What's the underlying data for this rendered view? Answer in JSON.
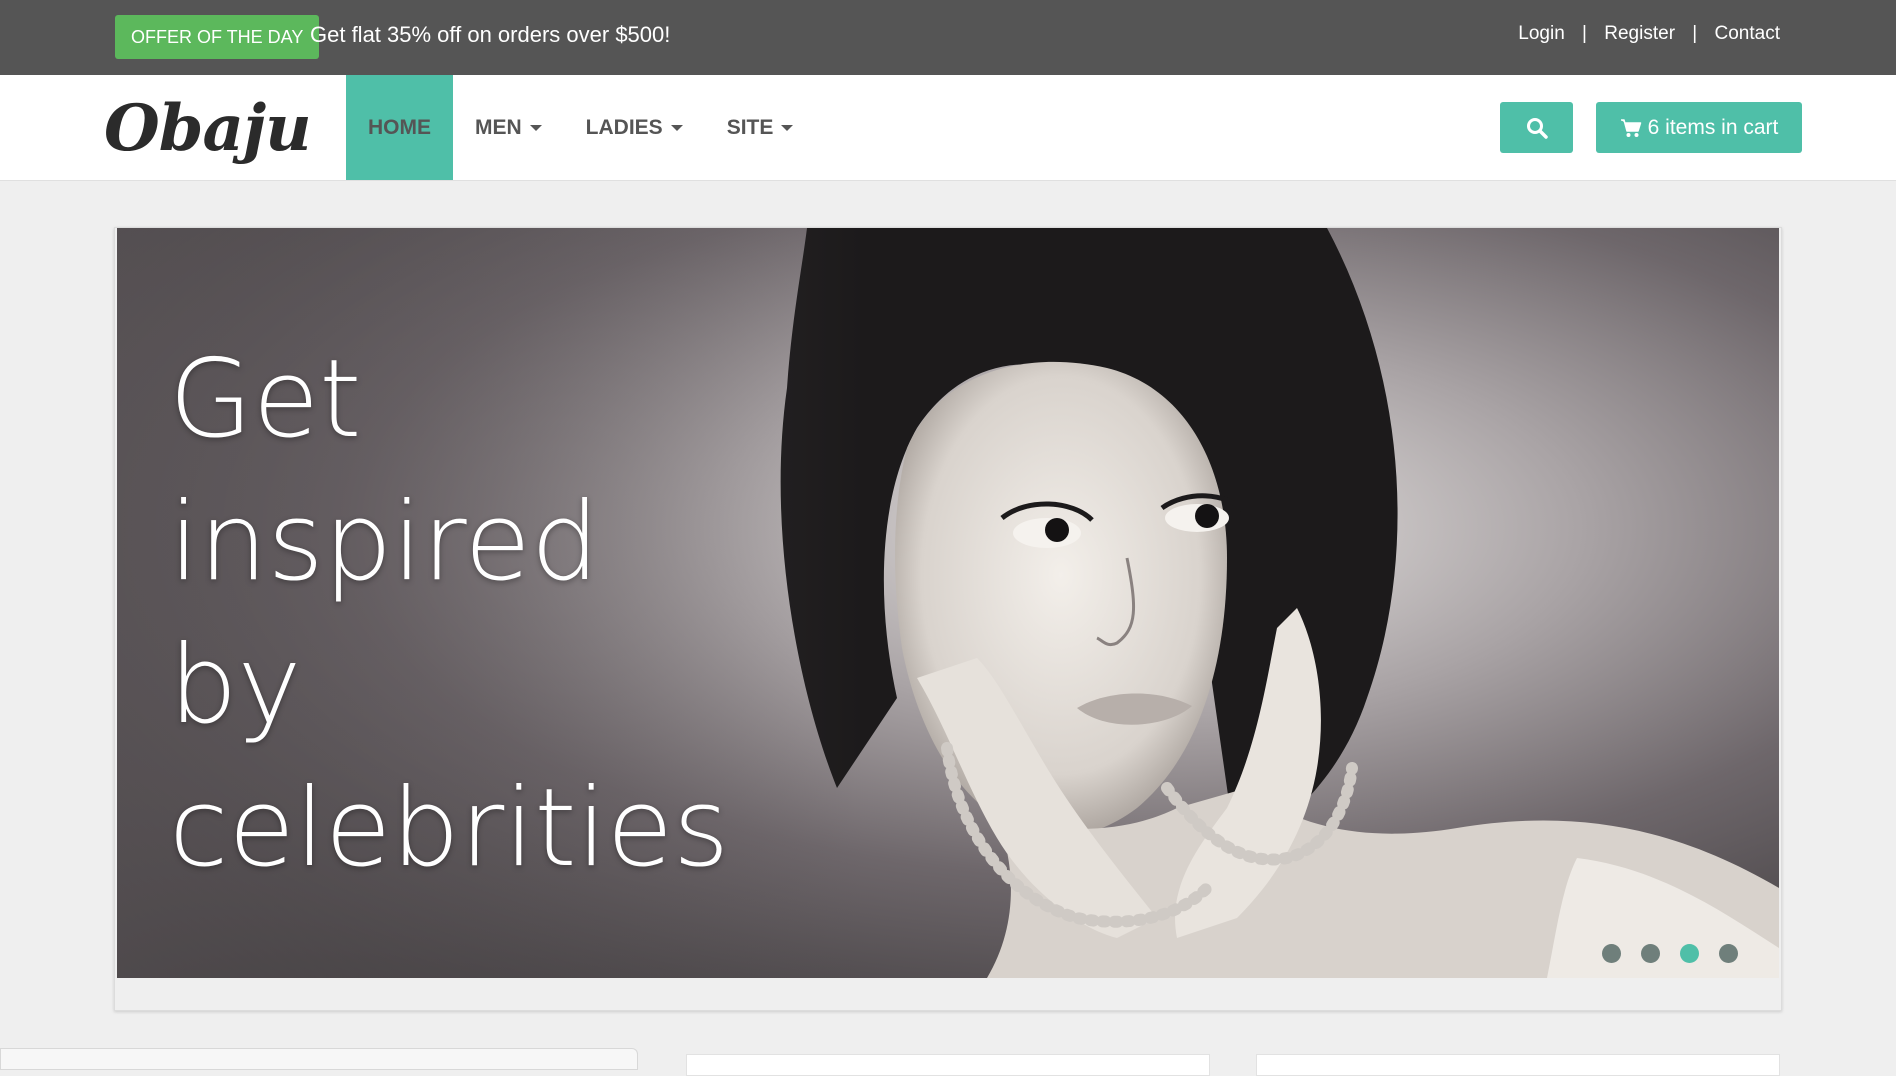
{
  "topbar": {
    "offer_badge": "OFFER OF THE DAY",
    "offer_text": "Get flat 35% off on orders over $500!",
    "links": [
      "Login",
      "Register",
      "Contact"
    ],
    "separator": "|"
  },
  "navbar": {
    "logo": "Obaju",
    "items": [
      {
        "label": "HOME",
        "active": true,
        "dropdown": false
      },
      {
        "label": "MEN",
        "active": false,
        "dropdown": true
      },
      {
        "label": "LADIES",
        "active": false,
        "dropdown": true
      },
      {
        "label": "SITE",
        "active": false,
        "dropdown": true
      }
    ],
    "search_icon": "search-icon",
    "cart_icon": "cart-icon",
    "cart_label": "6 items in cart"
  },
  "hero": {
    "headline_lines": [
      "Get",
      "inspired",
      "by",
      "celebrities"
    ],
    "slide_count": 4,
    "active_slide": 3
  },
  "colors": {
    "accent": "#4fbfa8",
    "offer_green": "#5cb85c",
    "topbar_bg": "#555555"
  }
}
